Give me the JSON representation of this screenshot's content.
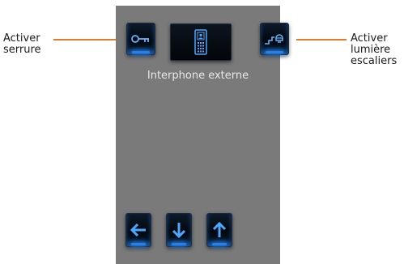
{
  "screen": {
    "label": "Interphone externe"
  },
  "buttons": {
    "lock": {
      "icon": "key-icon"
    },
    "intercom": {
      "icon": "entry-panel-icon"
    },
    "stairs_light": {
      "icon": "stairs-light-icon"
    },
    "back": {
      "icon": "arrow-left-icon"
    },
    "down": {
      "icon": "arrow-down-icon"
    },
    "up": {
      "icon": "arrow-up-icon"
    }
  },
  "callouts": {
    "left": {
      "line1": "Activer",
      "line2": "serrure"
    },
    "right": {
      "line1": "Activer",
      "line2": "lumière",
      "line3": "escaliers"
    }
  },
  "colors": {
    "panel": "#7a7a7a",
    "accent_glow": "#2a8cff",
    "leader_line": "#e07a2c"
  }
}
